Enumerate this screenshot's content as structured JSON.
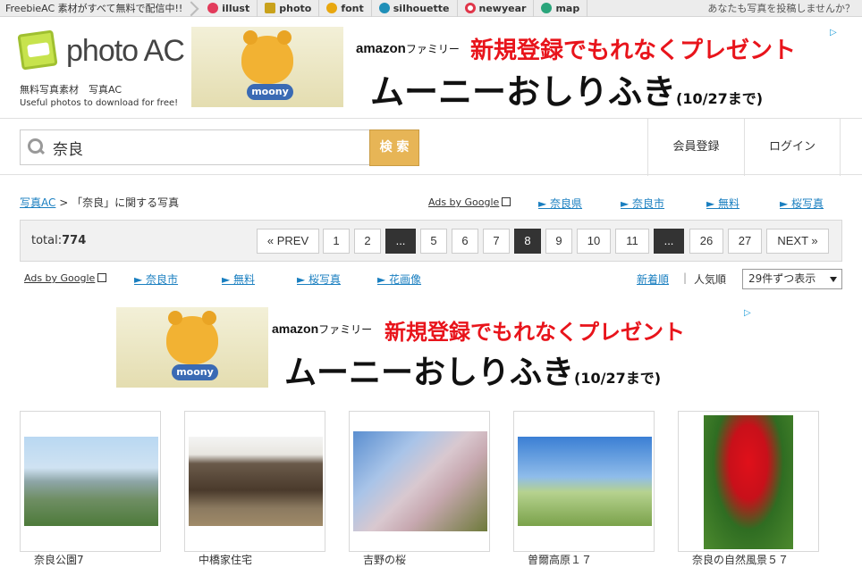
{
  "topbar": {
    "free_text": "FreebieAC 素材がすべて無料で配信中!!",
    "sites": [
      {
        "label": "illust",
        "color": "#e23b5b"
      },
      {
        "label": "photo",
        "color": "#c9a21c"
      },
      {
        "label": "font",
        "color": "#e8a70f"
      },
      {
        "label": "silhouette",
        "color": "#1f8fb8"
      },
      {
        "label": "newyear",
        "color": "#e0364a"
      },
      {
        "label": "map",
        "color": "#2aa57b"
      }
    ],
    "post_link": "あなたも写真を投稿しませんか？"
  },
  "header": {
    "logo": "photo AC",
    "logo_sub1": "無料写真素材　写真AC",
    "logo_sub2": "Useful photos to download for free!"
  },
  "ad": {
    "brand": "amazon",
    "brand_suffix": "ファミリー",
    "headline": "新規登録でもれなくプレゼント",
    "product": "ムーニーおしりふき",
    "until": "(10/27まで)",
    "package_label": "moony"
  },
  "search": {
    "value": "奈良",
    "button": "検 索"
  },
  "nav": {
    "register": "会員登録",
    "login": "ログイン"
  },
  "breadcrumb": {
    "home": "写真AC",
    "sep": ">",
    "current": "「奈良」に関する写真"
  },
  "ads_by_google": "Ads by Google",
  "ad_links_top": [
    "► 奈良県",
    "► 奈良市",
    "► 無料",
    "► 桜写真"
  ],
  "ad_links_bottom": [
    "► 奈良市",
    "► 無料",
    "► 桜写真",
    "► 花画像"
  ],
  "pager": {
    "total_label": "total:",
    "total_value": "774",
    "prev": "« PREV",
    "next": "NEXT »",
    "pages": [
      "1",
      "2",
      "...",
      "5",
      "6",
      "7",
      "8",
      "9",
      "10",
      "11",
      "...",
      "26",
      "27"
    ],
    "current": "8"
  },
  "sort": {
    "newest": "新着順",
    "separator": "|",
    "popular": "人気順",
    "per_page": "29件ずつ表示"
  },
  "photos": [
    {
      "caption": "奈良公園7"
    },
    {
      "caption": "中橋家住宅"
    },
    {
      "caption": "吉野の桜"
    },
    {
      "caption": "曽爾高原１７"
    },
    {
      "caption": "奈良の自然風景５７"
    }
  ]
}
